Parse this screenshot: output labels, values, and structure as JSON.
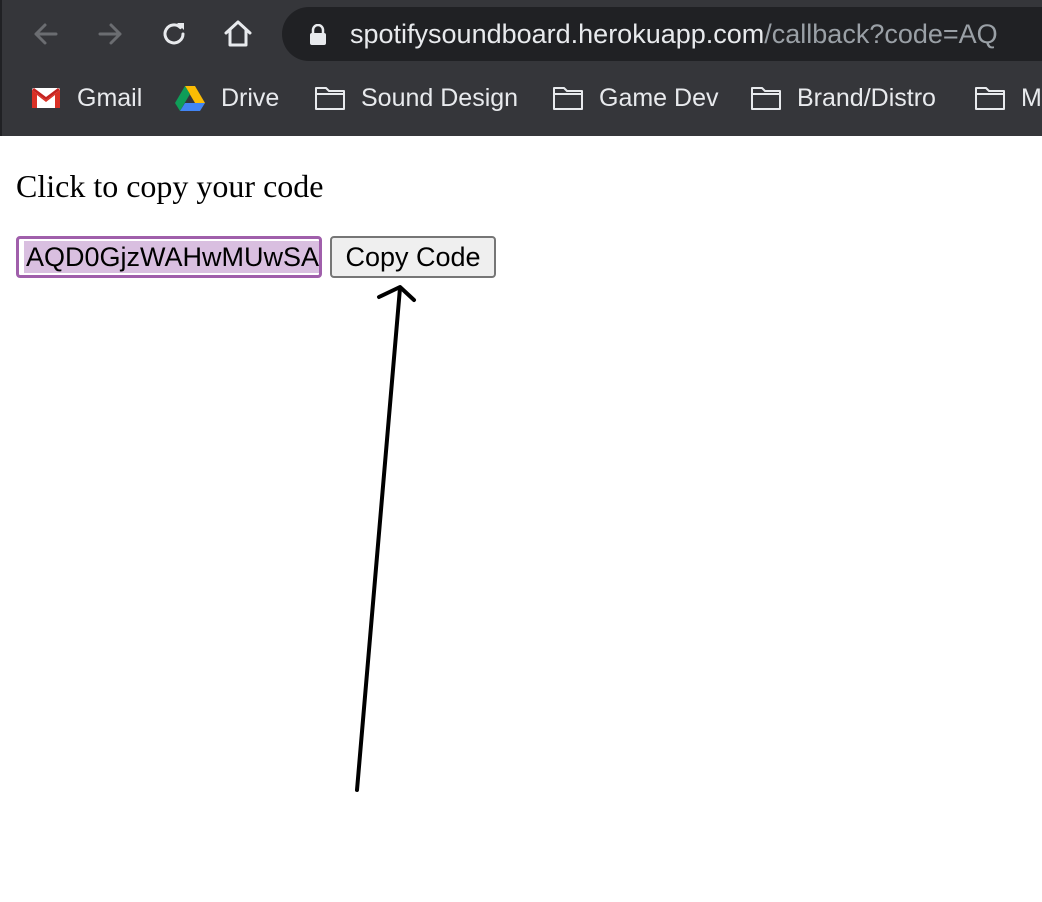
{
  "browser": {
    "url_host": "spotifysoundboard.herokuapp.com",
    "url_path": "/callback?code=AQ",
    "bookmarks": [
      {
        "label": "Gmail",
        "icon": "gmail-icon"
      },
      {
        "label": "Drive",
        "icon": "drive-icon"
      },
      {
        "label": "Sound Design",
        "icon": "folder-icon"
      },
      {
        "label": "Game Dev",
        "icon": "folder-icon"
      },
      {
        "label": "Brand/Distro",
        "icon": "folder-icon"
      },
      {
        "label": "M",
        "icon": "folder-icon"
      }
    ],
    "colors": {
      "chrome_bg": "#35363a",
      "omnibox_bg": "#202124"
    }
  },
  "page": {
    "instructions": "Click to copy your code",
    "code_value": "AQD0GjzWAHwMUwSA",
    "copy_button_label": "Copy Code",
    "colors": {
      "input_border": "#a05fab",
      "selection": "#d9bfe0"
    }
  }
}
